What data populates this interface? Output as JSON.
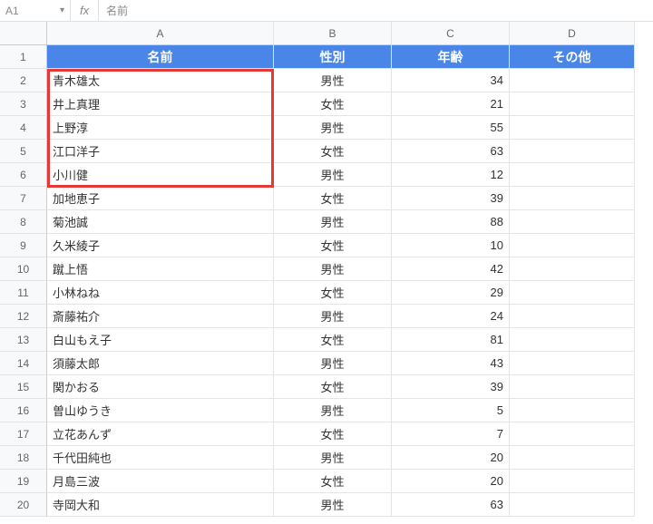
{
  "formula_bar": {
    "name_box": "A1",
    "fx": "fx",
    "formula_value": "名前"
  },
  "columns": [
    "A",
    "B",
    "C",
    "D"
  ],
  "row_numbers": [
    1,
    2,
    3,
    4,
    5,
    6,
    7,
    8,
    9,
    10,
    11,
    12,
    13,
    14,
    15,
    16,
    17,
    18,
    19,
    20
  ],
  "headers": {
    "name": "名前",
    "gender": "性別",
    "age": "年齢",
    "other": "その他"
  },
  "rows": [
    {
      "name": "青木雄太",
      "gender": "男性",
      "age": 34
    },
    {
      "name": "井上真理",
      "gender": "女性",
      "age": 21
    },
    {
      "name": "上野淳",
      "gender": "男性",
      "age": 55
    },
    {
      "name": "江口洋子",
      "gender": "女性",
      "age": 63
    },
    {
      "name": "小川健",
      "gender": "男性",
      "age": 12
    },
    {
      "name": "加地恵子",
      "gender": "女性",
      "age": 39
    },
    {
      "name": "菊池誠",
      "gender": "男性",
      "age": 88
    },
    {
      "name": "久米綾子",
      "gender": "女性",
      "age": 10
    },
    {
      "name": "蹴上悟",
      "gender": "男性",
      "age": 42
    },
    {
      "name": "小林ねね",
      "gender": "女性",
      "age": 29
    },
    {
      "name": "斎藤祐介",
      "gender": "男性",
      "age": 24
    },
    {
      "name": "白山もえ子",
      "gender": "女性",
      "age": 81
    },
    {
      "name": "須藤太郎",
      "gender": "男性",
      "age": 43
    },
    {
      "name": "関かおる",
      "gender": "女性",
      "age": 39
    },
    {
      "name": "曽山ゆうき",
      "gender": "男性",
      "age": 5
    },
    {
      "name": "立花あんず",
      "gender": "女性",
      "age": 7
    },
    {
      "name": "千代田純也",
      "gender": "男性",
      "age": 20
    },
    {
      "name": "月島三波",
      "gender": "女性",
      "age": 20
    },
    {
      "name": "寺岡大和",
      "gender": "男性",
      "age": 63
    }
  ]
}
